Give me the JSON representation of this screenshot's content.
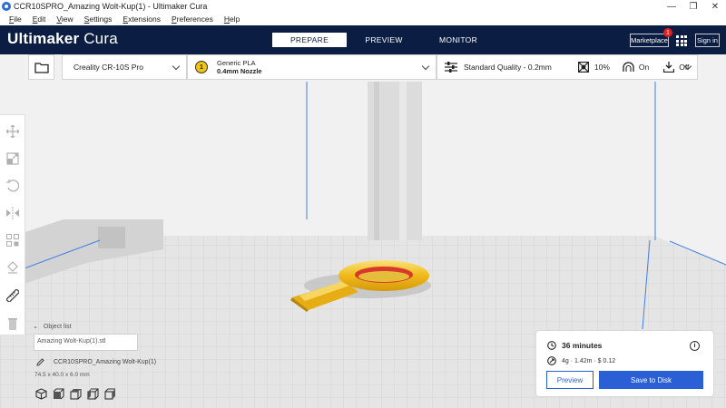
{
  "window": {
    "title": "CCR10SPRO_Amazing Wolt-Kup(1) - Ultimaker Cura",
    "minimize": "—",
    "maximize": "❐",
    "close": "✕"
  },
  "menu": {
    "items": [
      {
        "key": "F",
        "rest": "ile"
      },
      {
        "key": "E",
        "rest": "dit"
      },
      {
        "key": "V",
        "rest": "iew"
      },
      {
        "key": "S",
        "rest": "ettings"
      },
      {
        "key": "E",
        "rest": "xtensions"
      },
      {
        "key": "P",
        "rest": "references"
      },
      {
        "key": "H",
        "rest": "elp"
      }
    ]
  },
  "header": {
    "brand_bold": "Ultimaker",
    "brand_light": " Cura",
    "tabs": [
      {
        "label": "PREPARE",
        "active": true
      },
      {
        "label": "PREVIEW",
        "active": false
      },
      {
        "label": "MONITOR",
        "active": false
      }
    ],
    "marketplace_label": "Marketplace",
    "marketplace_badge": "1",
    "signin_label": "Sign in"
  },
  "toolbar": {
    "printer": "Creality CR-10S Pro",
    "material_badge": "1",
    "material_name": "Generic PLA",
    "nozzle": "0.4mm Nozzle",
    "quality": "Standard Quality - 0.2mm",
    "infill": "10%",
    "support": "On",
    "adhesion": "Off"
  },
  "objects": {
    "header": "Object list",
    "file": "Amazing Wolt-Kup(1).stl",
    "name": "CCR10SPRO_Amazing Wolt-Kup(1)",
    "dimensions": "74.5 x 40.0 x 6.0 mm"
  },
  "print_panel": {
    "time": "36 minutes",
    "info": "i",
    "material_info": "4g · 1.42m · $ 0.12",
    "preview_label": "Preview",
    "save_label": "Save to Disk"
  },
  "colors": {
    "header_bg": "#0b1d42",
    "accent": "#2a5fd6",
    "model": "#f0c020",
    "badge": "#e01e1e"
  }
}
